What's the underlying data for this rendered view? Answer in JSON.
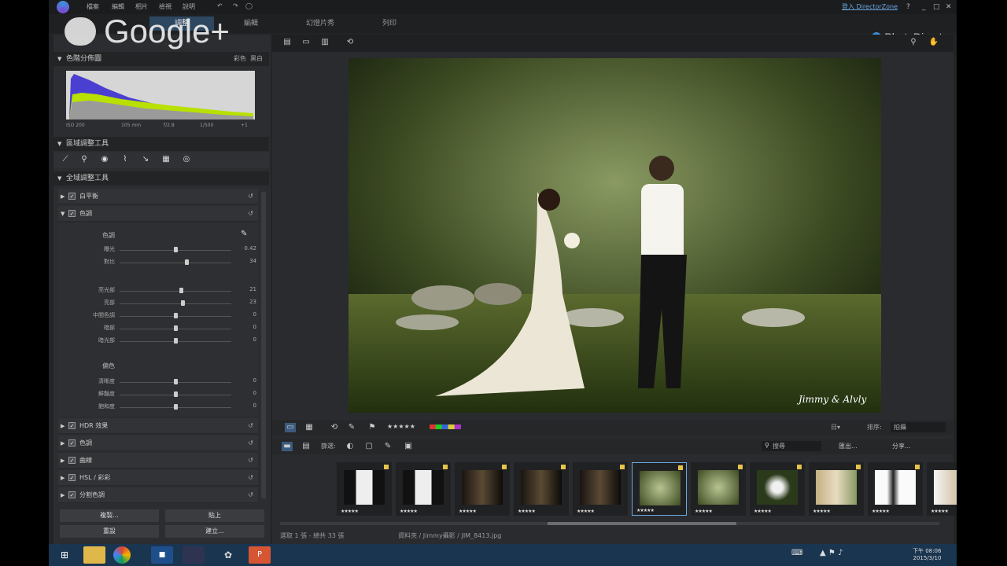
{
  "overlay": {
    "text": "Google+"
  },
  "menu": {
    "items": [
      "檔案",
      "編輯",
      "相片",
      "檢視",
      "說明"
    ]
  },
  "tabs": [
    {
      "label": "調整",
      "active": true
    },
    {
      "label": "編輯",
      "active": false
    },
    {
      "label": "幻燈片秀",
      "active": false
    },
    {
      "label": "列印",
      "active": false
    }
  ],
  "login": "登入 DirectorZone",
  "window_controls": [
    "?",
    "_",
    "□",
    "✕"
  ],
  "brand": "PhotoDirector",
  "histogram": {
    "title": "色階分佈圖",
    "opt1": "彩色",
    "opt2": "黑白",
    "info": [
      "ISO 200",
      "105 mm",
      "f/2.8",
      "1/500",
      "+1"
    ]
  },
  "regional": {
    "title": "區域調整工具",
    "tools": [
      "crop-tool-icon",
      "spot-removal-icon",
      "red-eye-icon",
      "brush-icon",
      "gradient-icon",
      "grid-icon",
      "radial-icon"
    ]
  },
  "global": {
    "title": "全域調整工具",
    "white_balance": "白平衡",
    "tone": "色調",
    "tone_header": "色調",
    "sliders1": [
      {
        "label": "曝光",
        "value": "0.42",
        "pos": 0.5
      },
      {
        "label": "對比",
        "value": "34",
        "pos": 0.6
      }
    ],
    "sliders2": [
      {
        "label": "亮光部",
        "value": "21",
        "pos": 0.55
      },
      {
        "label": "亮部",
        "value": "23",
        "pos": 0.56
      },
      {
        "label": "中間色調",
        "value": "0",
        "pos": 0.5
      },
      {
        "label": "暗部",
        "value": "0",
        "pos": 0.5
      },
      {
        "label": "暗光部",
        "value": "0",
        "pos": 0.5
      }
    ],
    "color_header": "偏色",
    "sliders3": [
      {
        "label": "清晰度",
        "value": "0",
        "pos": 0.5
      },
      {
        "label": "鮮豔度",
        "value": "0",
        "pos": 0.5
      },
      {
        "label": "飽和度",
        "value": "0",
        "pos": 0.5
      }
    ],
    "more": [
      "HDR 效果",
      "色調",
      "曲線",
      "HSL / 彩彩",
      "分割色調"
    ]
  },
  "bottom_buttons": [
    "複製...",
    "貼上",
    "重設",
    "建立..."
  ],
  "viewer": {
    "watermark": "Jimmy & Alvly"
  },
  "toolbar": {
    "stars": "★★★★★",
    "dropdown1": "日▾",
    "sort_label": "排序:",
    "sort_value": "拍攝",
    "filter_label": "篩選:"
  },
  "toolbar2": {
    "search_placeholder": "搜尋",
    "share1": "匯出...",
    "share2": "分享..."
  },
  "thumbnails": [
    {
      "stars": "★★★★★",
      "selected": false,
      "tone": "bw"
    },
    {
      "stars": "★★★★★",
      "selected": false,
      "tone": "bw"
    },
    {
      "stars": "★★★★★",
      "selected": false,
      "tone": "dark"
    },
    {
      "stars": "★★★★★",
      "selected": false,
      "tone": "dark"
    },
    {
      "stars": "★★★★★",
      "selected": false,
      "tone": "dark"
    },
    {
      "stars": "★★★★★",
      "selected": true,
      "tone": "green"
    },
    {
      "stars": "★★★★★",
      "selected": false,
      "tone": "green"
    },
    {
      "stars": "★★★★★",
      "selected": false,
      "tone": "darkgreen"
    },
    {
      "stars": "★★★★★",
      "selected": false,
      "tone": "warm"
    },
    {
      "stars": "★★★★★",
      "selected": false,
      "tone": "white"
    },
    {
      "stars": "★★★★★",
      "selected": false,
      "tone": "white2"
    }
  ],
  "status": {
    "left": "選取 1 張 - 總共 33 張",
    "path": "資料夾 / Jimmy攝影 / JIM_8413.jpg"
  },
  "taskbar": {
    "time": "下午 08:06",
    "date": "2015/3/10"
  }
}
